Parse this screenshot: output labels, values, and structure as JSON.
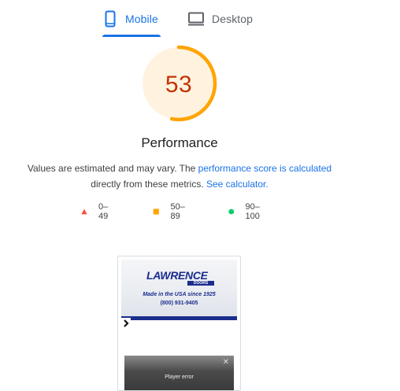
{
  "tabs": {
    "mobile_label": "Mobile",
    "desktop_label": "Desktop",
    "mobile_icon": "mobile-phone-icon",
    "desktop_icon": "desktop-monitor-icon",
    "active": "Mobile"
  },
  "score": {
    "value": "53",
    "fraction": 0.53,
    "label": "Performance",
    "color": "#c33300",
    "ring_color": "#ffa400",
    "ring_track_color": "#fff3e0"
  },
  "description": {
    "text_before": "Values are estimated and may vary. The ",
    "link_score": "performance score is calculated",
    "text_middle": "directly from these metrics. ",
    "link_calc": "See calculator."
  },
  "legend": {
    "fail_range": "0–49",
    "average_range": "50–89",
    "pass_range": "90–100",
    "fail_color": "#ff4e42",
    "average_color": "#ffa400",
    "pass_color": "#0cce6b"
  },
  "screenshot": {
    "logo_text": "LAWRENCE",
    "logo_sub": "DOORS",
    "tagline": "Made in the USA since 1925",
    "phone": "(800) 931-9405",
    "nav_icon": "chevron-right-icon",
    "player_message": "Player error",
    "player_close": "✕"
  }
}
